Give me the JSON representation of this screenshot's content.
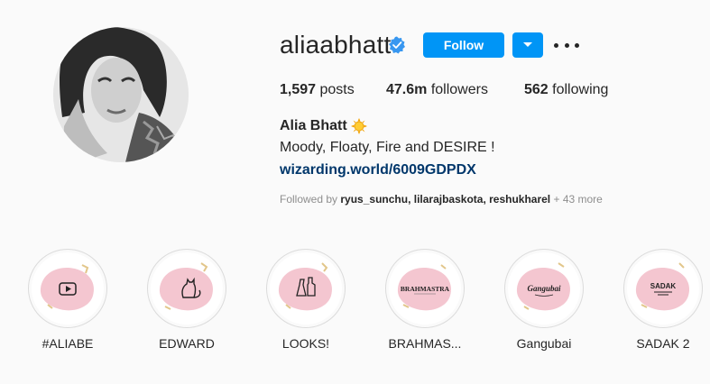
{
  "profile": {
    "username": "aliaabhatt",
    "follow_label": "Follow",
    "posts_count": "1,597",
    "posts_label": "posts",
    "followers_count": "47.6m",
    "followers_label": "followers",
    "following_count": "562",
    "following_label": "following",
    "full_name": "Alia Bhatt",
    "bio": "Moody, Floaty, Fire and DESIRE !",
    "link": "wizarding.world/6009GDPDX",
    "followed_by_prefix": "Followed by",
    "followed_by_names": "ryus_sunchu, lilarajbaskota, reshukharel",
    "followed_by_more": "+ 43 more"
  },
  "highlights": [
    {
      "label": "#ALIABE",
      "cover_icon": "play-icon"
    },
    {
      "label": "EDWARD",
      "cover_icon": "cat-icon"
    },
    {
      "label": "LOOKS!",
      "cover_icon": "dress-icon"
    },
    {
      "label": "BRAHMAS...",
      "cover_icon": "brahmastra-logo",
      "cover_text": "BRAHMASTRA"
    },
    {
      "label": "Gangubai",
      "cover_icon": "gangubai-logo",
      "cover_text": "Gangubai"
    },
    {
      "label": "SADAK 2",
      "cover_icon": "sadak-logo",
      "cover_text": "SADAK"
    }
  ],
  "colors": {
    "follow_button": "#0095f6",
    "link": "#00376b",
    "verified_badge": "#3897f0",
    "highlight_blob": "#f4c6d0"
  }
}
